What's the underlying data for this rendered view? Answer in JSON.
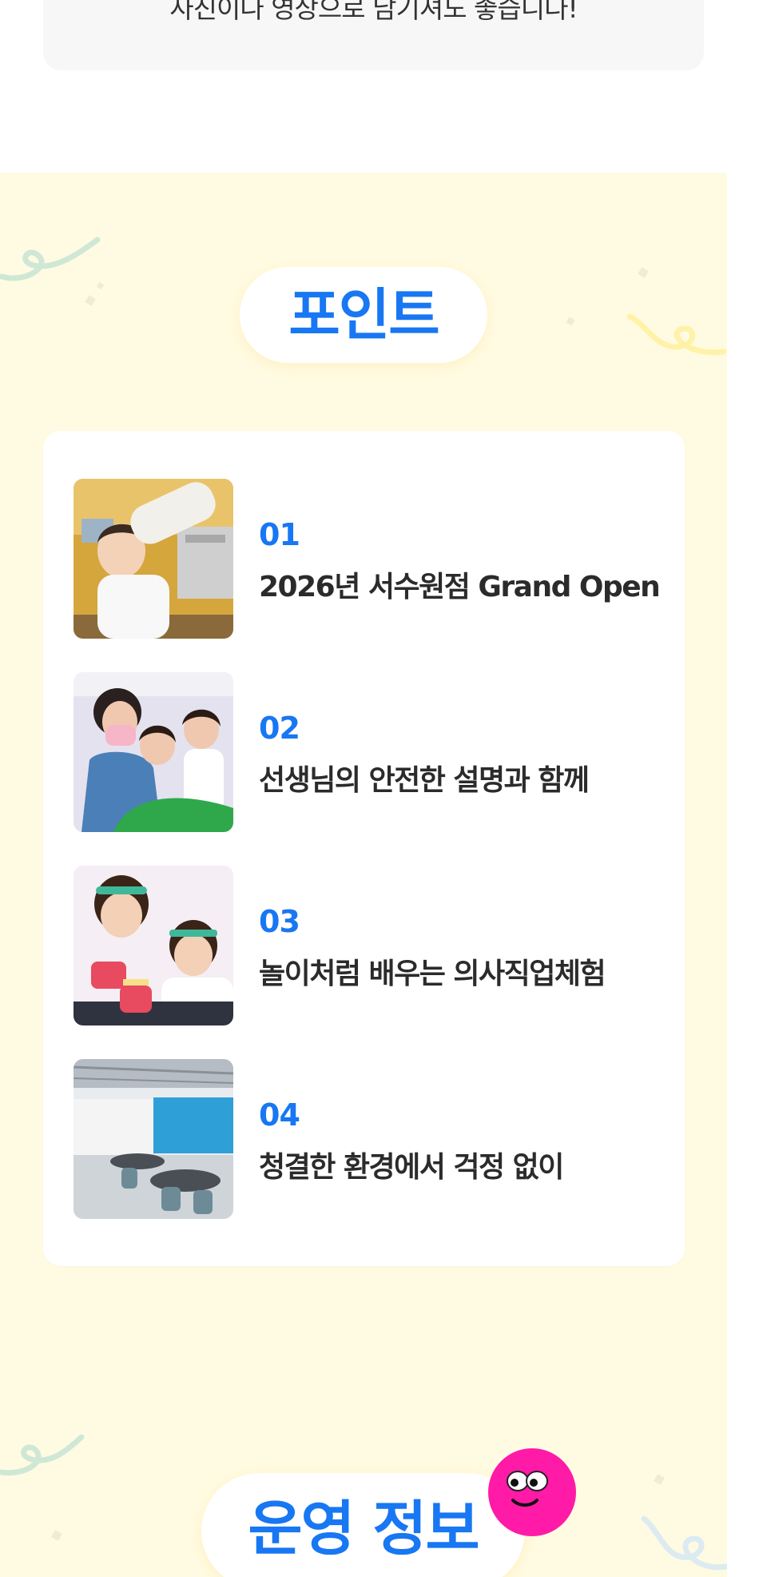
{
  "top_section": {
    "note": "사진이나 영상으로 남기셔도 좋습니다!"
  },
  "points_section": {
    "title": "포인트",
    "items": [
      {
        "number": "01",
        "title": "2026년 서수원점 Grand Open",
        "image": "child-holding-cast-photo"
      },
      {
        "number": "02",
        "title": "선생님의 안전한 설명과 함께",
        "image": "teacher-with-kids-photo"
      },
      {
        "number": "03",
        "title": "놀이처럼 배우는 의사직업체험",
        "image": "kids-dental-play-photo"
      },
      {
        "number": "04",
        "title": "청결한 환경에서 걱정 없이",
        "image": "clean-facility-photo"
      }
    ]
  },
  "operation_section": {
    "title": "운영 정보"
  },
  "colors": {
    "accent": "#1877f2",
    "section_bg": "#fffbe2",
    "mascot": "#ff1aa8",
    "heading_text": "#2b2b2b"
  }
}
